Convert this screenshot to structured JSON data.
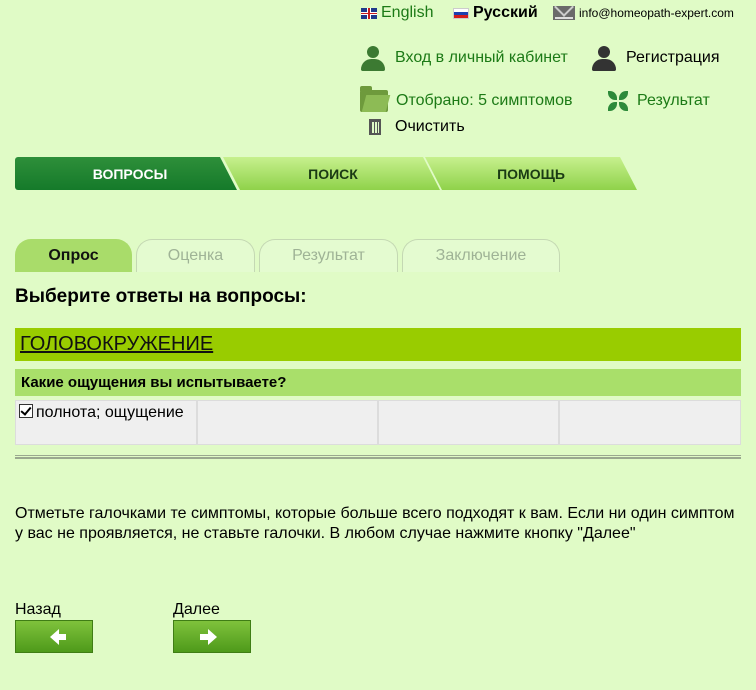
{
  "header": {
    "lang_english": "English",
    "lang_russian": "Русский",
    "email": "info@homeopath-expert.com",
    "login": "Вход в личный кабинет",
    "register": "Регистрация",
    "selected": "Отобрано: 5 симптомов",
    "result": "Результат",
    "clear": "Очистить"
  },
  "main_tabs": [
    "ВОПРОСЫ",
    "ПОИСК",
    "ПОМОЩЬ"
  ],
  "sub_tabs": [
    "Опрос",
    "Оценка",
    "Результат",
    "Заключение"
  ],
  "content": {
    "title": "Выберите ответы на вопросы:",
    "section": "ГОЛОВОКРУЖЕНИЕ",
    "question": "Какие ощущения вы испытываете?",
    "answer_1": "полнота; ощущение",
    "answer_1_checked": true,
    "note": "Отметьте галочками те симптомы, которые больше всего подходят к вам. Если ни один симптом у вас не проявляется, не ставьте галочки. В любом случае нажмите кнопку \"Далее\""
  },
  "nav": {
    "back": "Назад",
    "next": "Далее"
  },
  "colors": {
    "background": "#e0fbc6",
    "section": "#99cc00",
    "question": "#a9df6a",
    "active_tab": "#1e7f30",
    "link": "#1c7a16"
  }
}
